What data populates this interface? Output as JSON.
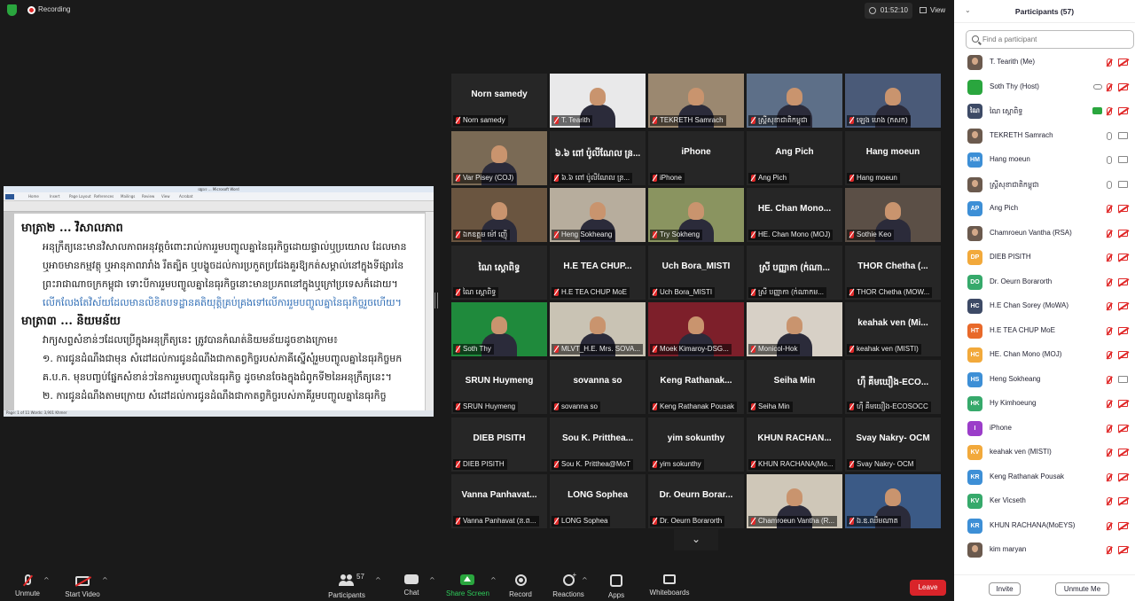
{
  "topbar": {
    "recording_label": "Recording",
    "timer": "01:52:10",
    "view_label": "View"
  },
  "shared_doc": {
    "window_title": "ផ្សេងៗ ... Microsoft Word",
    "ribbon_tabs": [
      "Home",
      "Insert",
      "Page Layout",
      "References",
      "Mailings",
      "Review",
      "View",
      "Acrobat"
    ],
    "lines": [
      {
        "kind": "h",
        "text": "មាត្រា២ ... វិសាលភាព"
      },
      {
        "kind": "p",
        "text": "អនុក្រឹត្យនេះមានវិសាលភាពអនុវត្តចំពោះរាល់ការរួមបញ្ចូលគ្នានៃធុរកិច្ចដោយផ្ទាល់ឬប្រយោល ដែលមាន"
      },
      {
        "kind": "p2",
        "text": "ឬអាចមានកម្មវត្ថុ ឬអានុភាពរារាំង រឹតត្បិត ឬបង្ខូចដល់ការប្រកួតប្រជែងគួរឱ្យកត់សម្គាល់នៅក្នុងទីផ្សារនៃ"
      },
      {
        "kind": "p2",
        "text": "ព្រះរាជាណាចក្រកម្ពុជា ទោះបីការរួមបញ្ចូលគ្នានៃធុរកិច្ចនោះមានប្រភពនៅក្នុងឬក្រៅប្រទេសក៏ដោយ។"
      },
      {
        "kind": "p2b",
        "text": "លើកលែងតែវិស័យដែលមានលិខិតបទដ្ឋានគតិយុត្តិគ្រប់គ្រងទៅលើការរួមបញ្ចូលគ្នានៃធុរកិច្ចរួចហើយ។"
      },
      {
        "kind": "h",
        "text": "មាត្រា៣ ... និយមន័យ"
      },
      {
        "kind": "p",
        "text": "វាក្យសព្ទសំខាន់ៗដែលប្រើក្នុងអនុក្រឹត្យនេះ ត្រូវបានកំណត់និយមន័យដូចខាងក្រោម៖"
      },
      {
        "kind": "p",
        "text": "១. ការជូនដំណឹងជាមុន សំដៅដល់ការជូនដំណឹងជាកាតព្វកិច្ចរបស់ភាគីស្នើសុំរួមបញ្ចូលគ្នានៃធុរកិច្ចមក"
      },
      {
        "kind": "p2",
        "text": "គ.ប.ក. មុនបញ្ចប់ផ្នែកសំខាន់ៗនៃការរួមបញ្ចូលនៃធុរកិច្ច ដូចមានចែងក្នុងជំពូកទី២នៃអនុក្រឹត្យនេះ។"
      },
      {
        "kind": "p",
        "text": "២. ការជូនដំណឹងតាមក្រោយ សំដៅដល់ការជូនដំណឹងជាកាតព្វកិច្ចរបស់ភាគីរួមបញ្ចូលគ្នានៃធុរកិច្ច"
      }
    ],
    "status_text": "Page: 1 of 11   Words: 3,901   Khmer"
  },
  "gallery": {
    "tiles": [
      {
        "big": "Norn samedy",
        "label": "Norn samedy",
        "video": false,
        "active": false
      },
      {
        "big": "",
        "label": "T. Tearith",
        "video": true,
        "active": false,
        "bg": "#e9e9ea"
      },
      {
        "big": "",
        "label": "TEKRETH Samrach",
        "video": true,
        "active": true,
        "bg": "#9b8870"
      },
      {
        "big": "",
        "label": "ស្រ្តីសុខាជាតិកម្ពុជា",
        "video": true,
        "active": false,
        "bg": "#5d6f88"
      },
      {
        "big": "",
        "label": "ឡេង ហេង (កសក)",
        "video": true,
        "active": false,
        "bg": "#4a5a78"
      },
      {
        "big": "",
        "label": "Var Pisey (COJ)",
        "video": true,
        "active": false,
        "bg": "#7a6a55"
      },
      {
        "big": "៦.៦ ពៅ ប៉ូលីណែល ន្រ...",
        "label": "៦.៦ ពៅ ប៉ូលីណែល ន្រ...",
        "video": false,
        "active": false
      },
      {
        "big": "iPhone",
        "label": "iPhone",
        "video": false,
        "active": false
      },
      {
        "big": "Ang Pich",
        "label": "Ang Pich",
        "video": false,
        "active": false
      },
      {
        "big": "Hang moeun",
        "label": "Hang moeun",
        "video": false,
        "active": false
      },
      {
        "big": "",
        "label": "ឯកឧត្តម ម៉ៅ ញ៉ើ",
        "video": true,
        "active": false,
        "bg": "#6a5540"
      },
      {
        "big": "",
        "label": "Heng Sokheang",
        "video": true,
        "active": false,
        "bg": "#b7ad9d"
      },
      {
        "big": "",
        "label": "Try Sokheng",
        "video": true,
        "active": false,
        "bg": "#8a9460"
      },
      {
        "big": "HE. Chan Mono...",
        "label": "HE. Chan Mono (MOJ)",
        "video": false,
        "active": false
      },
      {
        "big": "",
        "label": "Sothie Keo",
        "video": true,
        "active": false,
        "bg": "#5b4f46"
      },
      {
        "big": "ណៃ ស្តោពិទ្ធ",
        "label": "ណៃ ស្តោពិទ្ធ",
        "video": false,
        "active": false
      },
      {
        "big": "H.E TEA CHUP...",
        "label": "H.E TEA CHUP MoE",
        "video": false,
        "active": false
      },
      {
        "big": "Uch Bora_MISTI",
        "label": "Uch Bora_MISTI",
        "video": false,
        "active": false
      },
      {
        "big": "ស្រី បញ្ញាកា (ក់ណា...",
        "label": "ស្រី បញ្ញាកា (ក់ណាកម...",
        "video": false,
        "active": false
      },
      {
        "big": "THOR Chetha (...",
        "label": "THOR Chetha (MOW...",
        "video": false,
        "active": false
      },
      {
        "big": "",
        "label": "Soth Thy",
        "video": true,
        "active": false,
        "bg": "#1f8a3c"
      },
      {
        "big": "",
        "label": "MLVT_H.E. Mrs. SOVA...",
        "video": true,
        "active": false,
        "bg": "#c9c3b4"
      },
      {
        "big": "",
        "label": "Moek Kimaroy-DSG...",
        "video": true,
        "active": false,
        "bg": "#7d1f2a"
      },
      {
        "big": "",
        "label": "Monicol-Hok",
        "video": true,
        "active": false,
        "bg": "#d7d0c6"
      },
      {
        "big": "keahak ven (Mi...",
        "label": "keahak ven (MISTI)",
        "video": false,
        "active": false
      },
      {
        "big": "SRUN Huymeng",
        "label": "SRUN Huymeng",
        "video": false,
        "active": false
      },
      {
        "big": "sovanna so",
        "label": "sovanna so",
        "video": false,
        "active": false
      },
      {
        "big": "Keng Rathanak...",
        "label": "Keng Rathanak Pousak",
        "video": false,
        "active": false
      },
      {
        "big": "Seiha Min",
        "label": "Seiha Min",
        "video": false,
        "active": false
      },
      {
        "big": "ហ៊ឹ គឹមឃឿង-ECO...",
        "label": "ហ៊ឹ គឹមឃឿង-ECOSOCC",
        "video": false,
        "active": false
      },
      {
        "big": "DIEB PISITH",
        "label": "DIEB PISITH",
        "video": false,
        "active": false
      },
      {
        "big": "Sou K. Pritthea...",
        "label": "Sou K. Pritthea@MoT",
        "video": false,
        "active": false
      },
      {
        "big": "yim sokunthy",
        "label": "yim sokunthy",
        "video": false,
        "active": false
      },
      {
        "big": "KHUN RACHAN...",
        "label": "KHUN RACHANA(Mo...",
        "video": false,
        "active": false
      },
      {
        "big": "Svay Nakry- OCM",
        "label": "Svay Nakry- OCM",
        "video": false,
        "active": false
      },
      {
        "big": "Vanna Panhavat...",
        "label": "Vanna Panhavat (ន.ព...",
        "video": false,
        "active": false
      },
      {
        "big": "LONG Sophea",
        "label": "LONG Sophea",
        "video": false,
        "active": false
      },
      {
        "big": "Dr. Oeurn Borar...",
        "label": "Dr. Oeurn Borarorth",
        "video": false,
        "active": false
      },
      {
        "big": "",
        "label": "Chamroeun Vantha (R...",
        "video": true,
        "active": false,
        "bg": "#cfc7b8"
      },
      {
        "big": "",
        "label": "ឯ.ឧ.ឈឹមណាត",
        "video": true,
        "active": false,
        "bg": "#3b5a86"
      }
    ],
    "more_label": "⌄"
  },
  "toolbar": {
    "unmute_label": "Unmute",
    "video_label": "Start Video",
    "participants_label": "Participants",
    "participants_count": "57",
    "chat_label": "Chat",
    "share_label": "Share Screen",
    "record_label": "Record",
    "reactions_label": "Reactions",
    "apps_label": "Apps",
    "whiteboards_label": "Whiteboards",
    "leave_label": "Leave",
    "accent_share": "#2ecc5a",
    "leave_color": "#d9242a"
  },
  "participants_panel": {
    "title": "Participants (57)",
    "search_placeholder": "Find a participant",
    "invite_label": "Invite",
    "unmute_me_label": "Unmute Me",
    "people": [
      {
        "name": "T. Tearith (Me)",
        "avatar": "",
        "color": "",
        "mic": "muted",
        "cam": "off"
      },
      {
        "name": "Soth Thy (Host)",
        "avatar": "",
        "color": "#2aa63e",
        "mic": "muted",
        "cam": "off",
        "extra": "cloud"
      },
      {
        "name": "ណៃ ស្តោពិទ្ធ",
        "avatar": "ណៃ",
        "color": "#3d4a66",
        "mic": "muted",
        "cam": "off",
        "extra": "green"
      },
      {
        "name": "TEKRETH Samrach",
        "avatar": "",
        "color": "",
        "mic": "on",
        "cam": "on"
      },
      {
        "name": "Hang moeun",
        "avatar": "HM",
        "color": "#3d8fd6",
        "mic": "on",
        "cam": "on"
      },
      {
        "name": "ស្រ្តីសុខាជាតិកម្ពុជា",
        "avatar": "",
        "color": "",
        "mic": "on",
        "cam": "on"
      },
      {
        "name": "Ang Pich",
        "avatar": "AP",
        "color": "#3d8fd6",
        "mic": "muted",
        "cam": "off"
      },
      {
        "name": "Chamroeun Vantha (RSA)",
        "avatar": "",
        "color": "",
        "mic": "muted",
        "cam": "off"
      },
      {
        "name": "DIEB PISITH",
        "avatar": "DP",
        "color": "#f2a93b",
        "mic": "muted",
        "cam": "off"
      },
      {
        "name": "Dr. Oeurn Borarorth",
        "avatar": "DO",
        "color": "#36a96b",
        "mic": "muted",
        "cam": "off"
      },
      {
        "name": "H.E Chan Sorey (MoWA)",
        "avatar": "HC",
        "color": "#3d4a66",
        "mic": "muted",
        "cam": "off"
      },
      {
        "name": "H.E TEA CHUP MoE",
        "avatar": "HT",
        "color": "#e8692a",
        "mic": "muted",
        "cam": "off"
      },
      {
        "name": "HE. Chan Mono (MOJ)",
        "avatar": "HC",
        "color": "#f2a93b",
        "mic": "muted",
        "cam": "off"
      },
      {
        "name": "Heng Sokheang",
        "avatar": "HS",
        "color": "#3d8fd6",
        "mic": "muted",
        "cam": "on"
      },
      {
        "name": "Hy Kimhoeung",
        "avatar": "HK",
        "color": "#36a96b",
        "mic": "muted",
        "cam": "off"
      },
      {
        "name": "iPhone",
        "avatar": "I",
        "color": "#9b3dc9",
        "mic": "muted",
        "cam": "off"
      },
      {
        "name": "keahak ven (MISTI)",
        "avatar": "KV",
        "color": "#f2a93b",
        "mic": "muted",
        "cam": "off"
      },
      {
        "name": "Keng Rathanak Pousak",
        "avatar": "KR",
        "color": "#3d8fd6",
        "mic": "muted",
        "cam": "off"
      },
      {
        "name": "Ker Vicseth",
        "avatar": "KV",
        "color": "#36a96b",
        "mic": "muted",
        "cam": "off"
      },
      {
        "name": "KHUN RACHANA(MoEYS)",
        "avatar": "KR",
        "color": "#3d8fd6",
        "mic": "muted",
        "cam": "off"
      },
      {
        "name": "kim maryan",
        "avatar": "",
        "color": "",
        "mic": "muted",
        "cam": "off"
      }
    ]
  }
}
